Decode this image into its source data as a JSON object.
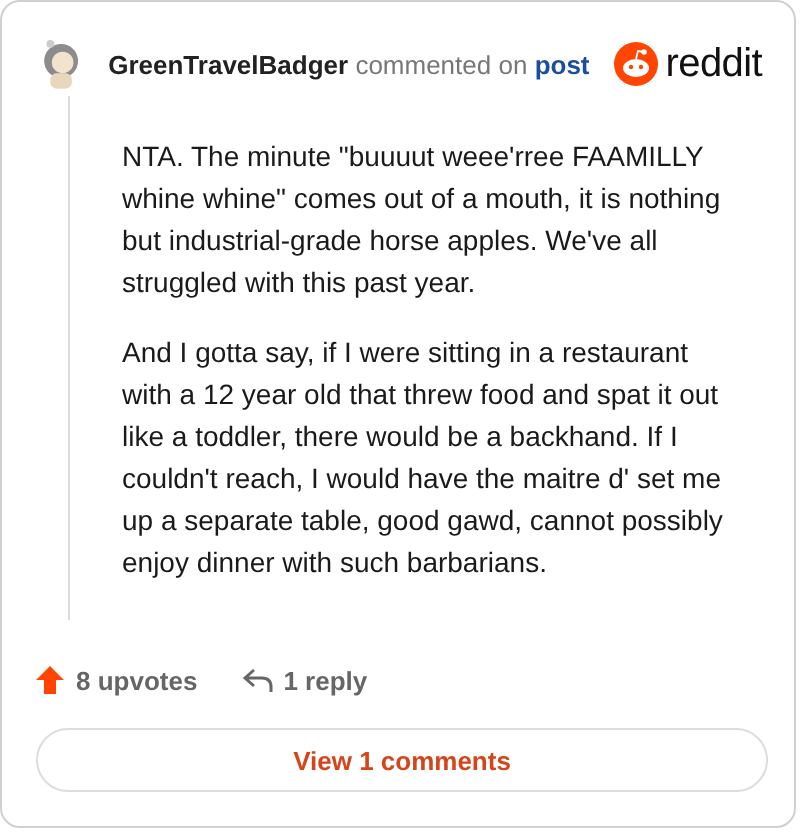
{
  "comment": {
    "author": "GreenTravelBadger",
    "action": "commented on",
    "target": "post",
    "brand": "reddit",
    "paragraphs": [
      "NTA. The minute \"buuuut weee'rree FAAMILLY whine whine\" comes out of a mouth, it is nothing but industrial-grade horse apples. We've all struggled with this past year.",
      "And I gotta say, if I were sitting in a restaurant with a 12 year old that threw food and spat it out like a toddler, there would be a backhand. If I couldn't reach, I would have the maitre d' set me up a separate table, good gawd, cannot possibly enjoy dinner with such barbarians."
    ],
    "upvotes": "8 upvotes",
    "replies": "1 reply"
  },
  "button": "View 1 comments"
}
